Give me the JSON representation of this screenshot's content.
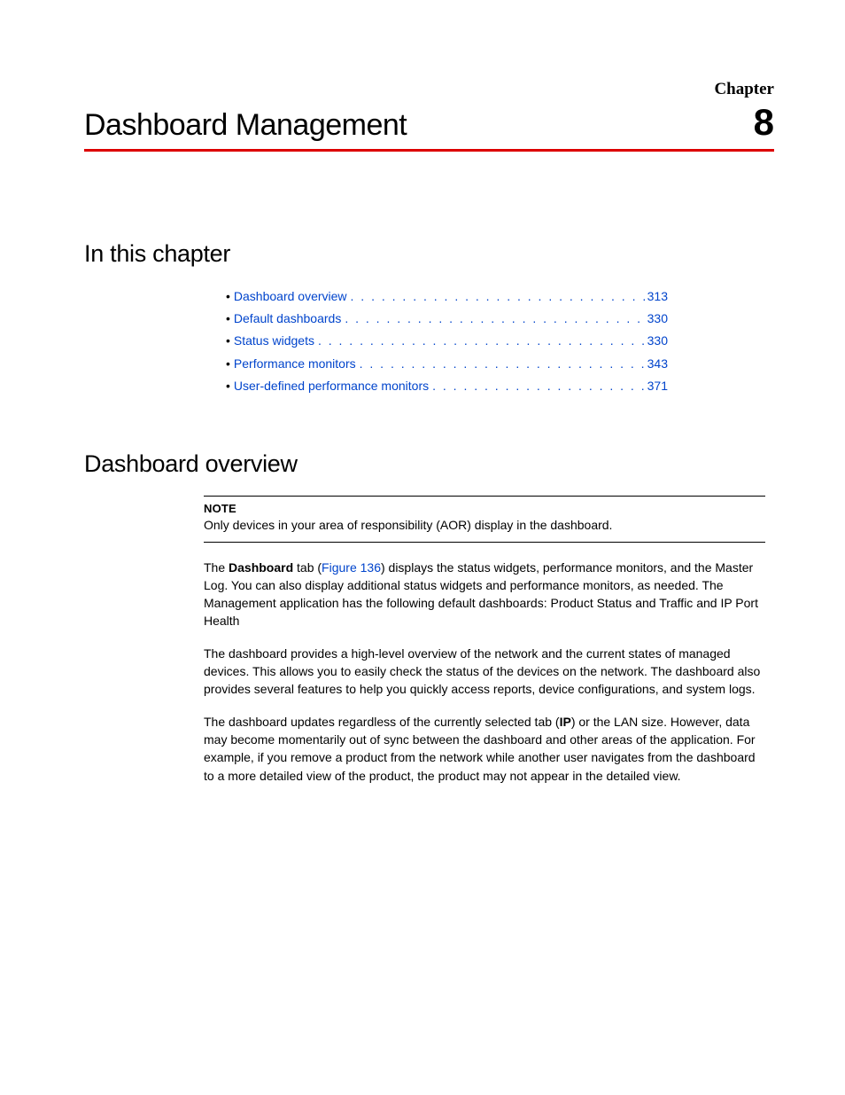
{
  "chapter": {
    "label": "Chapter",
    "number": "8",
    "title": "Dashboard Management"
  },
  "sections": {
    "in_this_chapter": "In this chapter",
    "dashboard_overview": "Dashboard overview"
  },
  "toc": [
    {
      "label": "Dashboard overview",
      "page": "313"
    },
    {
      "label": "Default dashboards",
      "page": "330"
    },
    {
      "label": "Status widgets",
      "page": "330"
    },
    {
      "label": "Performance monitors",
      "page": "343"
    },
    {
      "label": "User-defined performance monitors",
      "page": "371"
    }
  ],
  "note": {
    "label": "NOTE",
    "text": "Only devices in your area of responsibility (AOR) display in the dashboard."
  },
  "body": {
    "p1_pre": "The ",
    "p1_bold1": "Dashboard",
    "p1_mid1": " tab (",
    "p1_fig": "Figure 136",
    "p1_post": ") displays the status widgets, performance monitors, and the Master Log. You can also display additional status widgets and performance monitors, as needed. The Management application has the following default dashboards: Product Status and Traffic and IP Port Health",
    "p2": "The dashboard provides a high-level overview of the network and the current states of managed devices. This allows you to easily check the status of the devices on the network. The dashboard also provides several features to help you quickly access reports, device configurations, and system logs.",
    "p3_pre": "The dashboard updates regardless of the currently selected tab (",
    "p3_bold": "IP",
    "p3_post": ") or the LAN size. However, data may become momentarily out of sync between the dashboard and other areas of the application. For example, if you remove a product from the network while another user navigates from the dashboard to a more detailed view of the product, the product may not appear in the detailed view."
  }
}
